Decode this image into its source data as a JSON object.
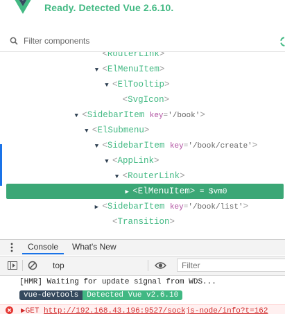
{
  "header": {
    "status": "Ready. Detected Vue 2.6.10.",
    "brand_color": "#42b983"
  },
  "filter": {
    "placeholder": "Filter components"
  },
  "tree": [
    {
      "indent": 9,
      "arrow": "",
      "name": "RouterLink",
      "attr": null,
      "partial": true
    },
    {
      "indent": 9,
      "arrow": "▼",
      "name": "ElMenuItem",
      "attr": null
    },
    {
      "indent": 10,
      "arrow": "▼",
      "name": "ElTooltip",
      "attr": null
    },
    {
      "indent": 11,
      "arrow": "",
      "name": "SvgIcon",
      "attr": null
    },
    {
      "indent": 7,
      "arrow": "▼",
      "name": "SidebarItem",
      "attr": {
        "key": "key",
        "value": "'/book'"
      }
    },
    {
      "indent": 8,
      "arrow": "▼",
      "name": "ElSubmenu",
      "attr": null
    },
    {
      "indent": 9,
      "arrow": "▼",
      "name": "SidebarItem",
      "attr": {
        "key": "key",
        "value": "'/book/create'"
      }
    },
    {
      "indent": 10,
      "arrow": "▼",
      "name": "AppLink",
      "attr": null
    },
    {
      "indent": 11,
      "arrow": "▼",
      "name": "RouterLink",
      "attr": null
    },
    {
      "indent": 12,
      "arrow": "▶",
      "name": "ElMenuItem",
      "attr": null,
      "selected": true,
      "vm": "$vm0"
    },
    {
      "indent": 9,
      "arrow": "▶",
      "name": "SidebarItem",
      "attr": {
        "key": "key",
        "value": "'/book/list'"
      }
    },
    {
      "indent": 10,
      "arrow": "",
      "name": "Transition",
      "attr": null
    }
  ],
  "drawer": {
    "tabs": [
      "Console",
      "What's New"
    ],
    "active_tab": "Console",
    "context": "top",
    "filter_placeholder": "Filter"
  },
  "console": {
    "hmr_line": "[HMR] Waiting for update signal from WDS...",
    "badge_left": "vue-devtools",
    "badge_right": "Detected Vue v2.6.10",
    "error_method": "GET",
    "error_url": "http://192.168.43.196:9527/sockjs-node/info?t=162"
  },
  "colors": {
    "selected_row": "#3ba776",
    "tag_name": "#42b983",
    "attr_key": "#b04fa0",
    "active_tab_underline": "#1a73e8",
    "error_text": "#d12f2f",
    "badge_dark": "#35495e",
    "badge_green": "#41b883"
  }
}
